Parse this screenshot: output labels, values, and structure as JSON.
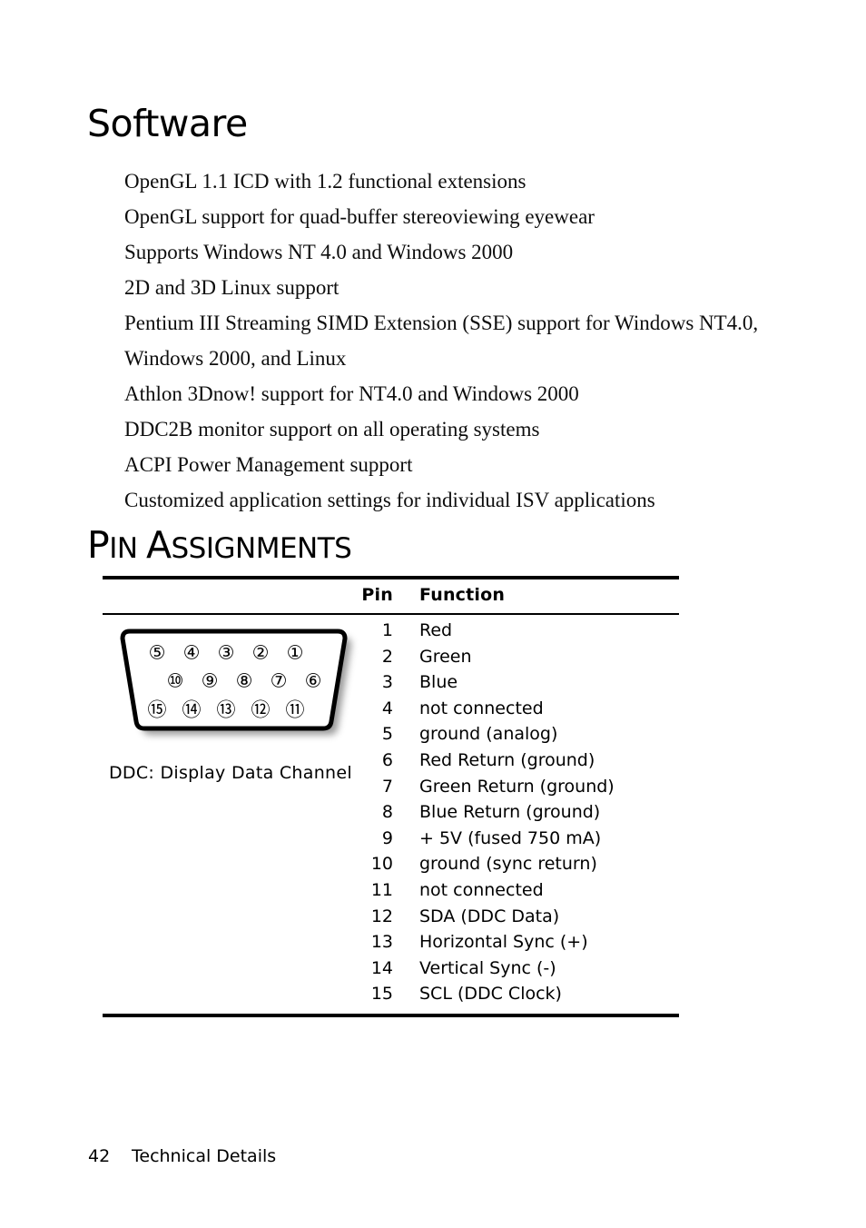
{
  "document": {
    "sections": {
      "software": {
        "heading": "Software",
        "items": [
          "OpenGL 1.1 ICD with 1.2 functional extensions",
          "OpenGL support for quad-buffer stereoviewing eyewear",
          "Supports Windows NT 4.0 and Windows 2000",
          "2D and 3D Linux support",
          "Pentium III Streaming SIMD Extension (SSE) support for Windows NT4.0, Windows 2000, and Linux",
          "Athlon 3Dnow! support for NT4.0 and Windows 2000",
          "DDC2B monitor support on all operating systems",
          "ACPI Power Management support",
          "Customized application settings for individual ISV applications"
        ]
      },
      "pin_assignments": {
        "heading_first_letter": "P",
        "heading_first_rest": "IN",
        "heading_second_letter": "A",
        "heading_second_rest": "SSIGNMENTS",
        "heading_full": "PIN ASSIGNMENTS",
        "table": {
          "columns": [
            "Pin",
            "Function"
          ],
          "rows": [
            {
              "pin": "1",
              "function": "Red"
            },
            {
              "pin": "2",
              "function": "Green"
            },
            {
              "pin": "3",
              "function": "Blue"
            },
            {
              "pin": "4",
              "function": "not connected"
            },
            {
              "pin": "5",
              "function": "ground (analog)"
            },
            {
              "pin": "6",
              "function": "Red Return (ground)"
            },
            {
              "pin": "7",
              "function": "Green Return (ground)"
            },
            {
              "pin": "8",
              "function": "Blue Return (ground)"
            },
            {
              "pin": "9",
              "function": "+ 5V (fused 750 mA)"
            },
            {
              "pin": "10",
              "function": "ground (sync return)"
            },
            {
              "pin": "11",
              "function": "not connected"
            },
            {
              "pin": "12",
              "function": "SDA (DDC Data)"
            },
            {
              "pin": "13",
              "function": "Horizontal Sync (+)"
            },
            {
              "pin": "14",
              "function": "Vertical Sync (-)"
            },
            {
              "pin": "15",
              "function": "SCL (DDC Clock)"
            }
          ]
        },
        "connector": {
          "caption": "DDC: Display Data Channel",
          "rows": [
            {
              "labels": [
                "⑤",
                "④",
                "③",
                "②",
                "①"
              ]
            },
            {
              "labels": [
                "⑩",
                "⑨",
                "⑧",
                "⑦",
                "⑥"
              ]
            },
            {
              "labels": [
                "⑮",
                "⑭",
                "⑬",
                "⑫",
                "⑪"
              ]
            }
          ]
        }
      }
    },
    "footer": {
      "page_number": "42",
      "section_name": "Technical Details"
    }
  }
}
